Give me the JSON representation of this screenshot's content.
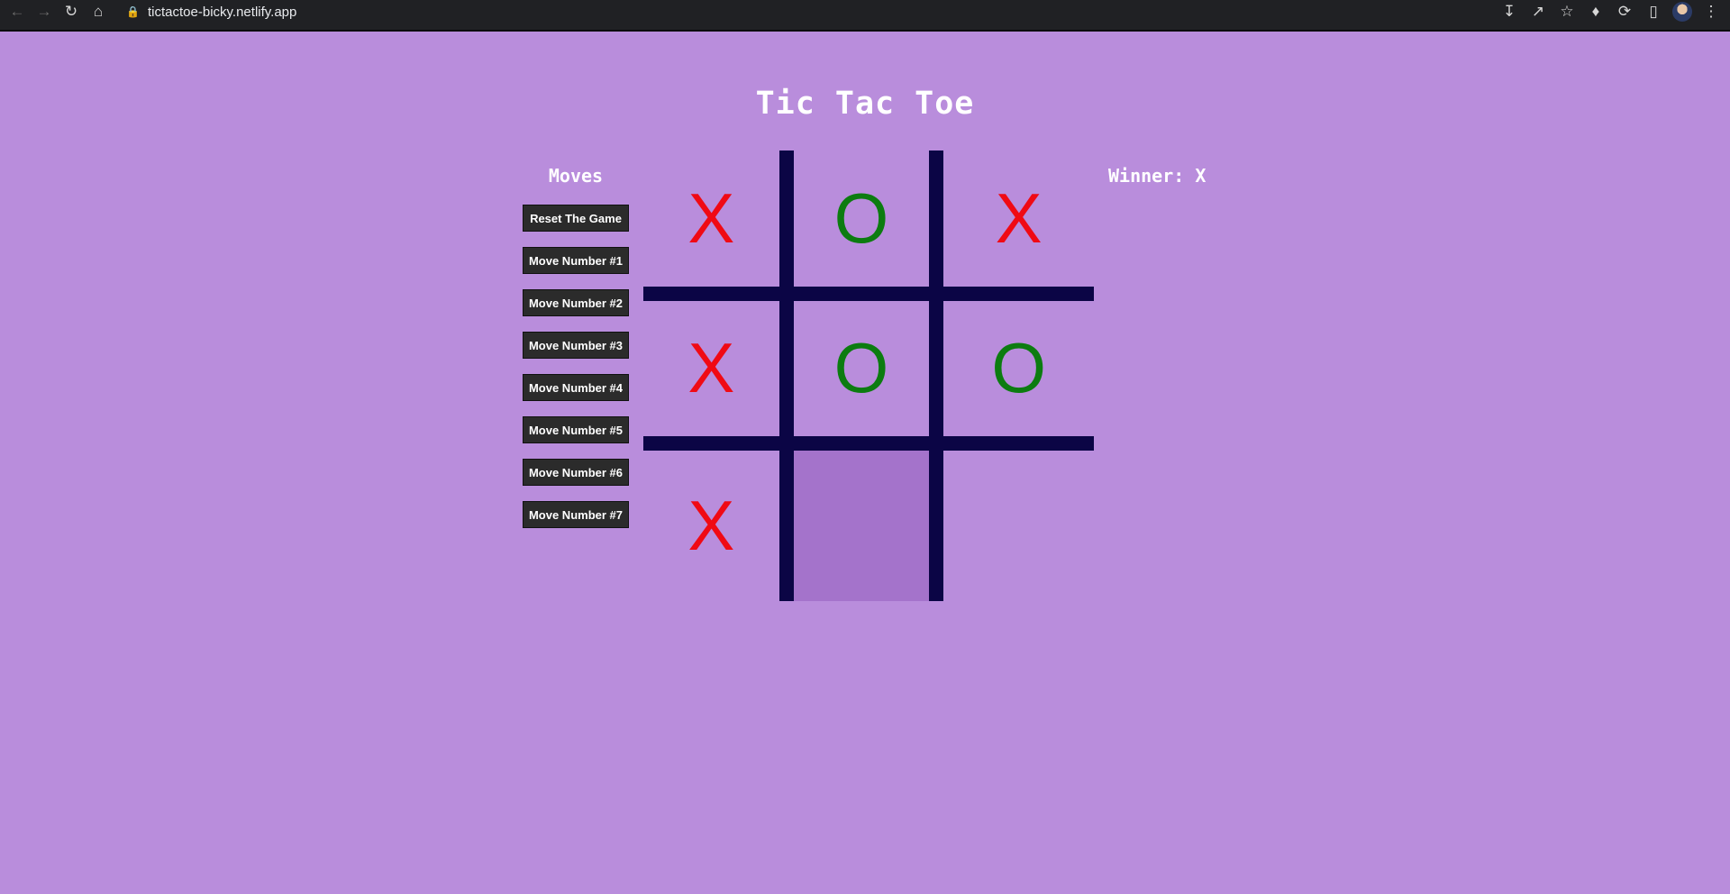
{
  "browser": {
    "url": "tictactoe-bicky.netlify.app"
  },
  "page": {
    "title": "Tic Tac Toe",
    "moves_heading": "Moves",
    "winner_text": "Winner: X",
    "move_buttons": [
      "Reset The Game",
      "Move Number #1",
      "Move Number #2",
      "Move Number #3",
      "Move Number #4",
      "Move Number #5",
      "Move Number #6",
      "Move Number #7"
    ],
    "board": [
      "X",
      "O",
      "X",
      "X",
      "O",
      "O",
      "X",
      "",
      ""
    ],
    "highlighted_cell": 7
  },
  "colors": {
    "background": "#b98ddc",
    "x_mark": "#f00a14",
    "o_mark": "#0c7c10",
    "grid_lines": "#0b0545",
    "button_bg": "#2b2b2b"
  },
  "icons": {
    "back": "arrow-left-icon",
    "forward": "arrow-right-icon",
    "reload": "reload-icon",
    "home": "home-icon",
    "lock": "lock-icon",
    "install": "install-icon",
    "share": "share-icon",
    "bookmark": "star-icon",
    "extensions": "puzzle-icon",
    "sync": "sync-icon",
    "sidepanel": "side-panel-icon",
    "menu": "kebab-menu-icon"
  }
}
